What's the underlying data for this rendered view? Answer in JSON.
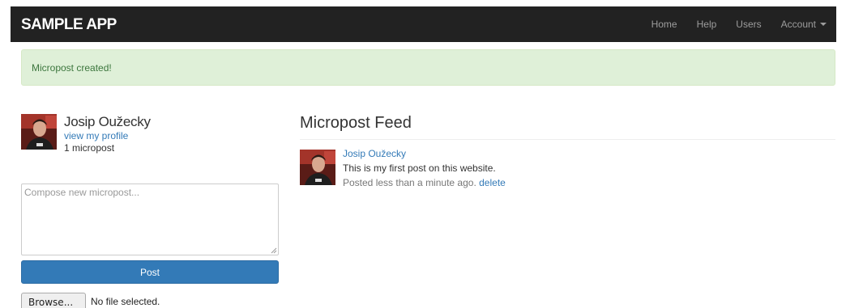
{
  "navbar": {
    "brand": "SAMPLE APP",
    "links": [
      "Home",
      "Help",
      "Users",
      "Account"
    ]
  },
  "alert": {
    "message": "Micropost created!",
    "color": "#dff0d8"
  },
  "user": {
    "name": "Josip Oužecky",
    "profile_link": "view my profile",
    "post_count": "1 micropost",
    "avatar_icon": "avatar"
  },
  "compose": {
    "placeholder": "Compose new micropost...",
    "value": "",
    "submit_label": "Post",
    "browse_label": "Browse...",
    "file_status": "No file selected."
  },
  "feed": {
    "title": "Micropost Feed",
    "items": [
      {
        "user": "Josip Oužecky",
        "content": "This is my first post on this website.",
        "timestamp": "Posted less than a minute ago.",
        "delete_label": "delete"
      }
    ]
  },
  "colors": {
    "navbar_bg": "#222222",
    "link": "#337ab7",
    "primary_button": "#337ab7",
    "alert_text": "#3c763d"
  }
}
